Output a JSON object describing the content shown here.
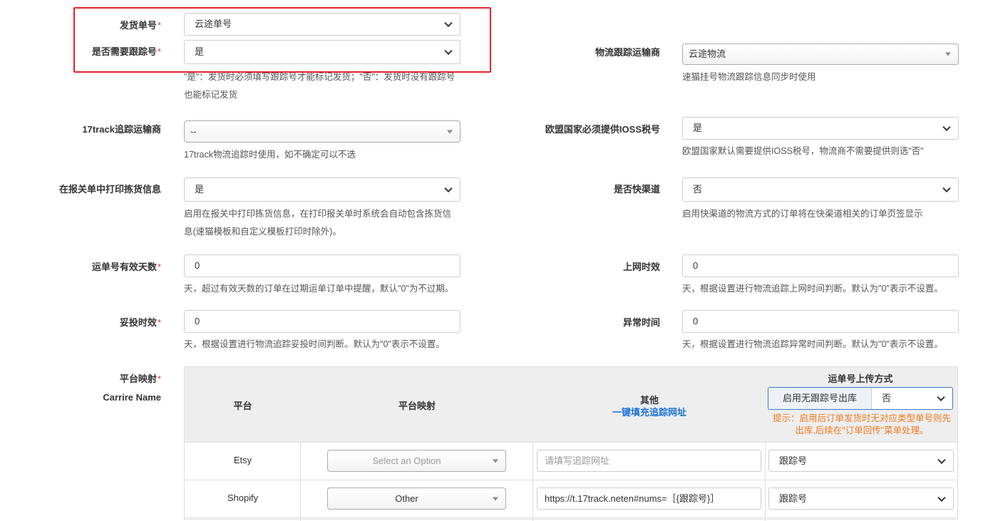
{
  "shipping_no": {
    "label": "发货单号",
    "value": "云途单号"
  },
  "need_tracking": {
    "label": "是否需要跟踪号",
    "value": "是",
    "hint_line1": "\"是\"：发货时必须填写跟踪号才能标记发货；\"否\"：发货时没有跟踪号",
    "hint_line2": "也能标记发货"
  },
  "logistics_carrier": {
    "label": "物流跟踪运输商",
    "value": "云途物流",
    "hint": "速猫挂号物流跟踪信息同步时使用"
  },
  "track17_carrier": {
    "label": "17track追踪运输商",
    "value": "--",
    "hint": "17track物流追踪时使用，如不确定可以不选"
  },
  "eu_ioss": {
    "label": "欧盟国家必须提供IOSS税号",
    "value": "是",
    "hint": "欧盟国家默认需要提供IOSS税号，物流商不需要提供则选\"否\""
  },
  "print_picking": {
    "label": "在报关单中打印拣货信息",
    "value": "是",
    "hint_line1": "启用在报关中打印拣货信息，在打印报关单时系统会自动包含拣货信",
    "hint_line2": "息(速猫模板和自定义模板打印时除外)。"
  },
  "fast_channel": {
    "label": "是否快渠道",
    "value": "否",
    "hint": "启用快渠道的物流方式的订单将在快渠道相关的订单页签显示"
  },
  "waybill_valid_days": {
    "label": "运单号有效天数",
    "value": "0",
    "hint": "天，超过有效天数的订单在过期运单订单中提醒，默认\"0\"为不过期。"
  },
  "online_time": {
    "label": "上网时效",
    "value": "0",
    "hint": "天，根据设置进行物流追踪上网时间判断。默认为\"0\"表示不设置。"
  },
  "delivery_time": {
    "label": "妥投时效",
    "value": "0",
    "hint": "天，根据设置进行物流追踪妥投时间判断。默认为\"0\"表示不设置。"
  },
  "abnormal_time": {
    "label": "异常时间",
    "value": "0",
    "hint": "天，根据设置进行物流追踪异常时间判断。默认为\"0\"表示不设置。"
  },
  "platform_mapping": {
    "label": "平台映射",
    "sublabel": "Carrire Name",
    "headers": {
      "platform": "平台",
      "mapping": "平台映射",
      "other": "其他",
      "autofill_link": "一键填充追踪网址",
      "upload": "运单号上传方式"
    },
    "no_tracking_label": "启用无跟踪号出库",
    "no_tracking_value": "否",
    "warning_line1": "提示：启用后订单发货时无对应类型单号则先",
    "warning_line2": "出库,后续在\"订单回传\"菜单处理。",
    "rows": [
      {
        "platform": "Etsy",
        "mapping": "Select an Option",
        "url": "",
        "url_placeholder": "请填写追踪网址",
        "upload": "跟踪号"
      },
      {
        "platform": "Shopify",
        "mapping": "Other",
        "url": "https://t.17track.neten#nums=［{跟踪号}］",
        "url_placeholder": "",
        "upload": "跟踪号"
      }
    ]
  },
  "colors": {
    "required": "#e4393c",
    "highlight_box": "#e8232a",
    "link": "#1a73d9",
    "warning": "#f07a1e"
  }
}
